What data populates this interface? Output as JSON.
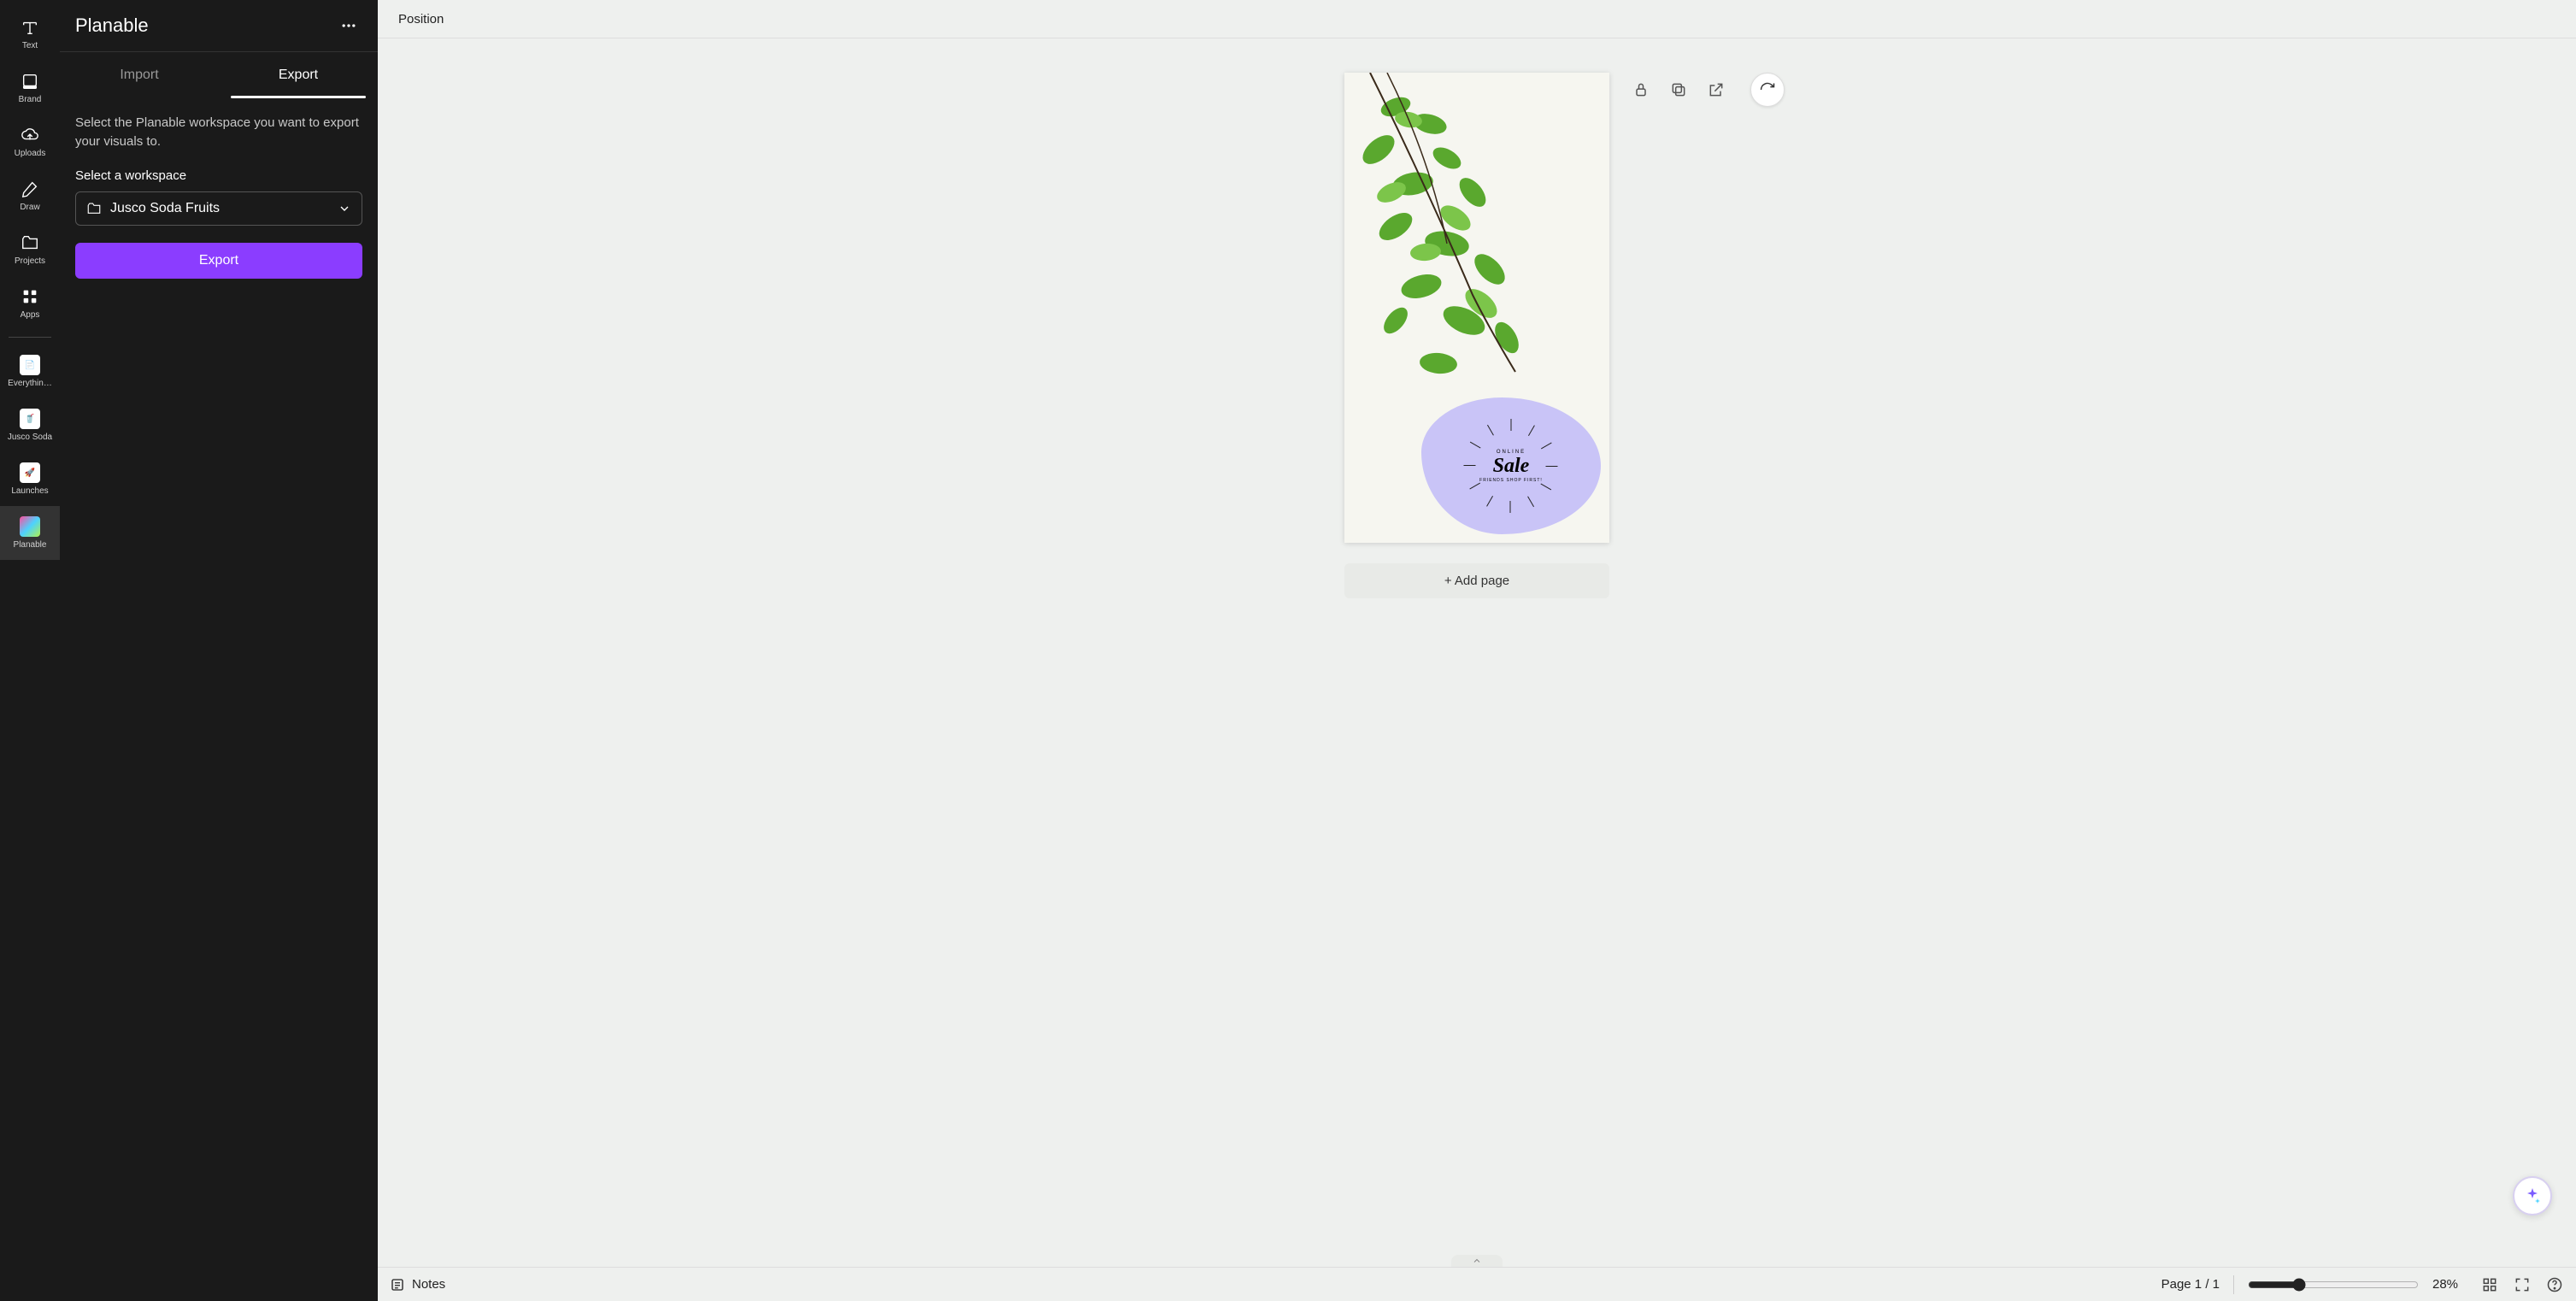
{
  "sidebar": {
    "items": [
      {
        "label": "Text",
        "icon": "text-icon"
      },
      {
        "label": "Brand",
        "icon": "brand-icon"
      },
      {
        "label": "Uploads",
        "icon": "uploads-icon"
      },
      {
        "label": "Draw",
        "icon": "draw-icon"
      },
      {
        "label": "Projects",
        "icon": "projects-icon"
      },
      {
        "label": "Apps",
        "icon": "apps-icon"
      }
    ],
    "recent": [
      {
        "label": "Everythin…"
      },
      {
        "label": "Jusco Soda"
      },
      {
        "label": "Launches"
      },
      {
        "label": "Planable",
        "selected": true
      }
    ]
  },
  "panel": {
    "title": "Planable",
    "tabs": [
      {
        "label": "Import",
        "active": false
      },
      {
        "label": "Export",
        "active": true
      }
    ],
    "description": "Select the Planable workspace you want to export your visuals to.",
    "workspace_label": "Select a workspace",
    "workspace_value": "Jusco Soda Fruits",
    "export_button": "Export"
  },
  "canvas": {
    "topbar": {
      "position": "Position"
    },
    "artboard": {
      "overline": "ONLINE",
      "title": "Sale",
      "tagline": "FRIENDS SHOP FIRST!"
    },
    "add_page": "+ Add page"
  },
  "bottombar": {
    "notes": "Notes",
    "page_indicator": "Page 1 / 1",
    "zoom": "28%"
  },
  "colors": {
    "accent": "#8b3dff",
    "blob": "#c9c4f7"
  }
}
